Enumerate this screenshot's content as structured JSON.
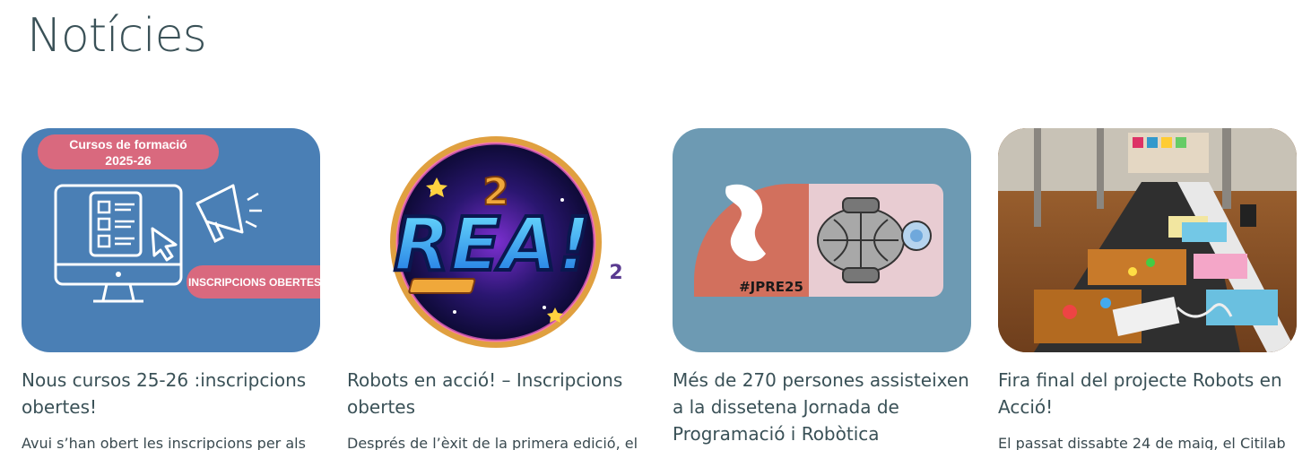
{
  "section": {
    "title": "Notícies"
  },
  "cards": [
    {
      "title": "Nous cursos 25-26 :inscripcions obertes!",
      "excerpt": "Avui s’han obert les inscripcions per als",
      "image": {
        "badge_line1": "Cursos de formació",
        "badge_line2": "2025-26",
        "banner": "INSCRIPCIONS OBERTES",
        "bg": "#4a7fb5",
        "badge_color": "#d9697e"
      }
    },
    {
      "title": "Robots en acció! – Inscripcions obertes",
      "excerpt": "Després de l’èxit de la primera edició, el",
      "image": {
        "logo_text": "REA!",
        "logo_sub": "2"
      }
    },
    {
      "title": "Més de 270 persones assisteixen a la dissetena Jornada de Programació i Robòtica",
      "excerpt": "",
      "image": {
        "hashtag": "#JPRE25",
        "bg": "#6d9ab3",
        "accent": "#d2705d"
      }
    },
    {
      "title": "Fira final del projecte Robots en Acció!",
      "excerpt": "El passat dissabte 24 de maig, el Citilab",
      "image": {
        "alt_icon": "photo-icon"
      }
    }
  ]
}
